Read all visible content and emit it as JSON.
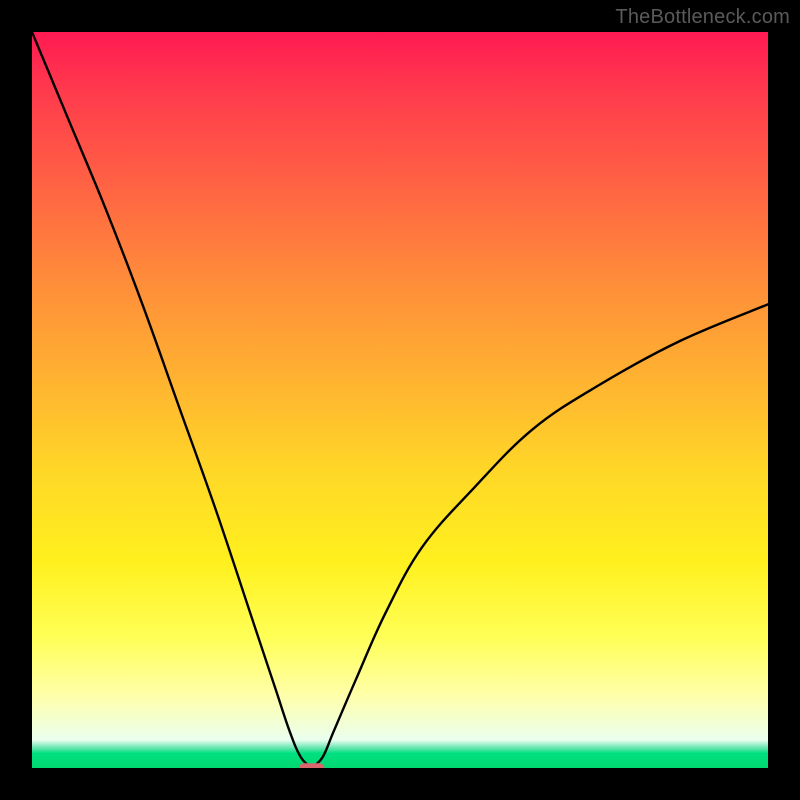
{
  "attribution": "TheBottleneck.com",
  "chart_data": {
    "type": "line",
    "title": "",
    "xlabel": "",
    "ylabel": "",
    "x_range": [
      0,
      100
    ],
    "y_range": [
      0,
      100
    ],
    "minimum_x": 38,
    "left_curve": {
      "name": "left-branch",
      "x": [
        0,
        5,
        10,
        15,
        20,
        25,
        30,
        33,
        35,
        36.5,
        38
      ],
      "y": [
        100,
        88,
        76,
        63,
        49,
        35,
        20,
        11,
        5,
        1.5,
        0
      ]
    },
    "right_curve": {
      "name": "right-branch",
      "x": [
        38,
        39.5,
        41,
        44,
        48,
        53,
        60,
        68,
        77,
        88,
        100
      ],
      "y": [
        0,
        1.5,
        5,
        12,
        21,
        30,
        38,
        46,
        52,
        58,
        63
      ]
    },
    "marker": {
      "x": 38,
      "y": 0,
      "color": "#d9666c",
      "width_frac": 0.035,
      "height_frac": 0.013
    },
    "background_gradient_stops": [
      {
        "pos": 0.0,
        "color": "#ff1a52"
      },
      {
        "pos": 0.33,
        "color": "#ff8a3a"
      },
      {
        "pos": 0.6,
        "color": "#ffd827"
      },
      {
        "pos": 0.9,
        "color": "#ffffa8"
      },
      {
        "pos": 1.0,
        "color": "#00d870"
      }
    ]
  }
}
